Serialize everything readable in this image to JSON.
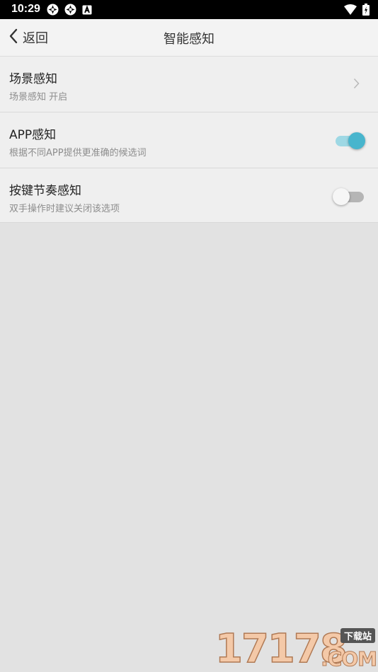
{
  "status_bar": {
    "time": "10:29",
    "left_icons": [
      "sync-icon",
      "sync-icon",
      "a-notification-icon"
    ],
    "right_icons": [
      "wifi-icon",
      "battery-charging-icon"
    ]
  },
  "header": {
    "back_label": "返回",
    "title": "智能感知"
  },
  "settings": [
    {
      "title": "场景感知",
      "subtitle": "场景感知 开启",
      "control": "chevron"
    },
    {
      "title": "APP感知",
      "subtitle": "根据不同APP提供更准确的候选词",
      "control": "toggle",
      "on": true
    },
    {
      "title": "按键节奏感知",
      "subtitle": "双手操作时建议关闭该选项",
      "control": "toggle",
      "on": false
    }
  ],
  "watermark": {
    "digits": "17178",
    "badge": "下载站",
    "suffix": ".COM"
  },
  "colors": {
    "accent": "#48b5cd",
    "accent_track": "#9ed8e4",
    "background": "#e2e2e2",
    "list_background": "#efefef"
  }
}
